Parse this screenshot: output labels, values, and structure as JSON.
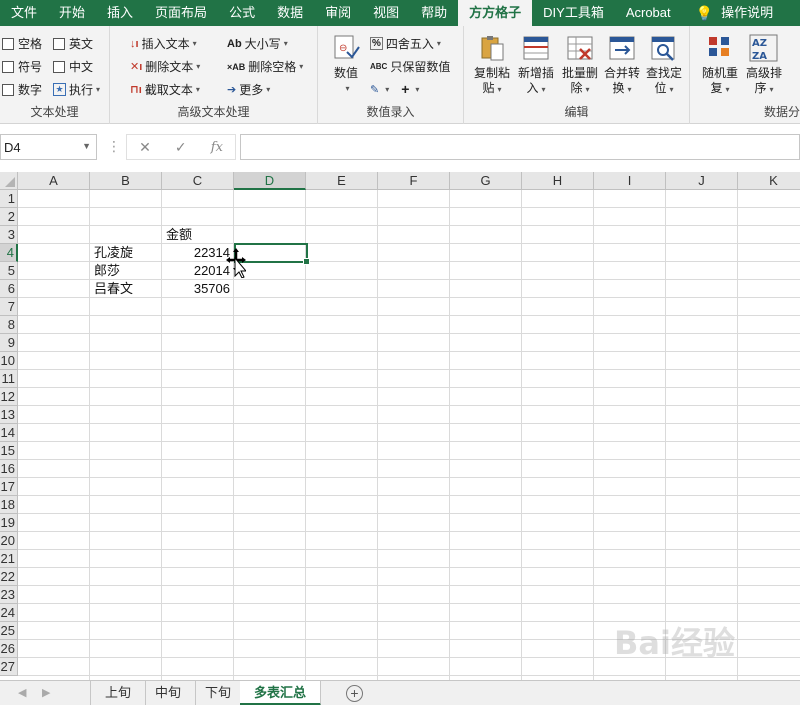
{
  "menu": {
    "tabs": [
      "文件",
      "开始",
      "插入",
      "页面布局",
      "公式",
      "数据",
      "审阅",
      "视图",
      "帮助",
      "方方格子",
      "DIY工具箱",
      "Acrobat"
    ],
    "active": "方方格子",
    "tell_me": "操作说明"
  },
  "ribbon": {
    "text_group": {
      "label": "文本处理",
      "checkboxes": [
        "空格",
        "英文",
        "符号",
        "中文",
        "数字"
      ],
      "execute": "执行"
    },
    "adv_text_group": {
      "label": "高级文本处理",
      "insert_text": "插入文本",
      "delete_text": "删除文本",
      "extract_text": "截取文本",
      "case": "大小写",
      "delete_spaces": "删除空格",
      "more": "更多"
    },
    "number_group": {
      "label": "数值录入",
      "value": "数值",
      "round": "四舍五入",
      "keep_values": "只保留数值"
    },
    "edit_group": {
      "label": "编辑",
      "copy_paste": [
        "复制粘",
        "贴"
      ],
      "add_insert": [
        "新增插",
        "入"
      ],
      "batch_delete": [
        "批量删",
        "除"
      ],
      "merge_convert": [
        "合并转",
        "换"
      ],
      "find_locate": [
        "查找定",
        "位"
      ]
    },
    "data_group": {
      "label": "数据分",
      "random_repeat": [
        "随机重",
        "复"
      ],
      "advanced_sort": [
        "高级排",
        "序"
      ]
    }
  },
  "formula_bar": {
    "name_box": "D4",
    "fx": "fx",
    "content": ""
  },
  "sheet": {
    "columns": [
      "A",
      "B",
      "C",
      "D",
      "E",
      "F",
      "G",
      "H",
      "I",
      "J",
      "K"
    ],
    "selected_column": "D",
    "rows": [
      "1",
      "2",
      "3",
      "4",
      "5",
      "6",
      "7",
      "8",
      "9",
      "10",
      "11",
      "12",
      "13",
      "14",
      "15",
      "16",
      "17",
      "18",
      "19",
      "20",
      "21",
      "22",
      "23",
      "24",
      "25",
      "26",
      "27"
    ],
    "selected_row": "4",
    "cells": {
      "C3": "金额",
      "B4": "孔凌旋",
      "C4": "22314",
      "B5": "郎莎",
      "C5": "22014",
      "B6": "吕春文",
      "C6": "35706"
    }
  },
  "sheet_tabs": {
    "tabs": [
      "上旬",
      "中旬",
      "下旬",
      "多表汇总"
    ],
    "active": "多表汇总"
  },
  "colors": {
    "accent": "#217346",
    "ribbon_bg": "#f3f3f3",
    "grid_line": "#dadada"
  },
  "watermark": "Bai经验"
}
